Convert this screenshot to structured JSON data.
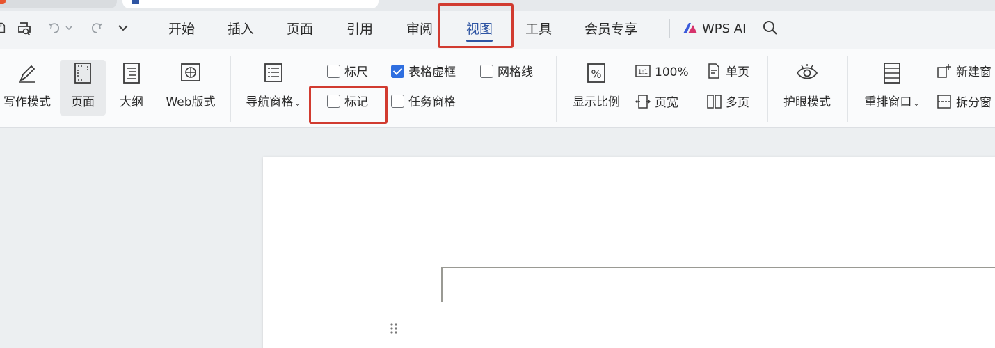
{
  "menu": {
    "tabs": [
      {
        "label": "开始"
      },
      {
        "label": "插入"
      },
      {
        "label": "页面"
      },
      {
        "label": "引用"
      },
      {
        "label": "审阅"
      },
      {
        "label": "视图",
        "active": true
      },
      {
        "label": "工具"
      },
      {
        "label": "会员专享"
      }
    ],
    "wps_ai": "WPS AI",
    "quick_access_icons": [
      "save-icon",
      "print-preview-icon",
      "undo-icon",
      "dropdown-icon",
      "redo-icon",
      "more-chevron-icon"
    ]
  },
  "ribbon": {
    "views": [
      {
        "label": "写作模式",
        "icon": "pen-icon"
      },
      {
        "label": "页面",
        "icon": "page-view-icon",
        "pressed": true
      },
      {
        "label": "大纲",
        "icon": "outline-icon"
      },
      {
        "label": "Web版式",
        "icon": "globe-icon"
      }
    ],
    "nav_pane": {
      "label": "导航窗格",
      "icon": "nav-pane-icon"
    },
    "checkboxes": {
      "ruler": {
        "label": "标尺",
        "checked": false
      },
      "table_gridlines": {
        "label": "表格虚框",
        "checked": true
      },
      "gridlines": {
        "label": "网格线",
        "checked": false
      },
      "marks": {
        "label": "标记",
        "checked": false
      },
      "task_pane": {
        "label": "任务窗格",
        "checked": false
      }
    },
    "zoom": {
      "label": "显示比例",
      "hundred_label": "100%",
      "hundred_icon_text": "1:1",
      "page_width_label": "页宽",
      "single_page_label": "单页",
      "multi_page_label": "多页"
    },
    "eye_care": {
      "label": "护眼模式",
      "icon": "eye-icon"
    },
    "arrange": {
      "label": "重排窗口",
      "icon": "rearrange-icon"
    },
    "new_window": {
      "label": "新建窗"
    },
    "split_window": {
      "label": "拆分窗"
    }
  },
  "colors": {
    "accent": "#2f55a3",
    "highlight": "#d13b30",
    "checkbox_on": "#2f6fe0"
  }
}
